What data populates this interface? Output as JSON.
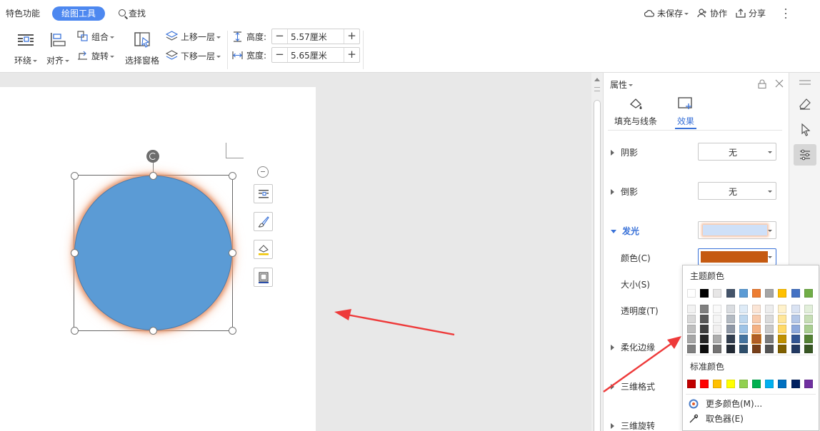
{
  "tabs": {
    "special": "特色功能",
    "draw_tools": "绘图工具",
    "search": "查找"
  },
  "top_right": {
    "unsaved": "未保存",
    "coop": "协作",
    "share": "分享"
  },
  "ribbon": {
    "wrap": "环绕",
    "align": "对齐",
    "group": "组合",
    "rotate": "旋转",
    "select_pane": "选择窗格",
    "bring_forward": "上移一层",
    "send_backward": "下移一层",
    "height_label": "高度:",
    "height_value": "5.57厘米",
    "width_label": "宽度:",
    "width_value": "5.65厘米"
  },
  "panel": {
    "title": "属性",
    "tab_fill": "填充与线条",
    "tab_effect": "效果",
    "shadow": "阴影",
    "shadow_value": "无",
    "reflection": "倒影",
    "reflection_value": "无",
    "glow": "发光",
    "color": "颜色(C)",
    "size": "大小(S)",
    "transparency": "透明度(T)",
    "soft_edge": "柔化边缘",
    "three_d_format": "三维格式",
    "three_d_rotation": "三维旋转"
  },
  "picker": {
    "theme_title": "主题颜色",
    "standard_title": "标准颜色",
    "more_colors": "更多颜色(M)...",
    "eyedropper": "取色器(E)"
  },
  "colors": {
    "glow_color": "#c55a11",
    "accent": "#3a72d8",
    "shape_fill": "#5b9bd5",
    "theme_row": [
      "#ffffff",
      "#000000",
      "#e7e6e6",
      "#44546a",
      "#5b9bd5",
      "#ed7d31",
      "#a5a5a5",
      "#ffc000",
      "#4472c4",
      "#70ad47"
    ],
    "standard_row": [
      "#c00000",
      "#ff0000",
      "#ffc000",
      "#ffff00",
      "#92d050",
      "#00b050",
      "#00b0f0",
      "#0070c0",
      "#002060",
      "#7030a0"
    ]
  }
}
